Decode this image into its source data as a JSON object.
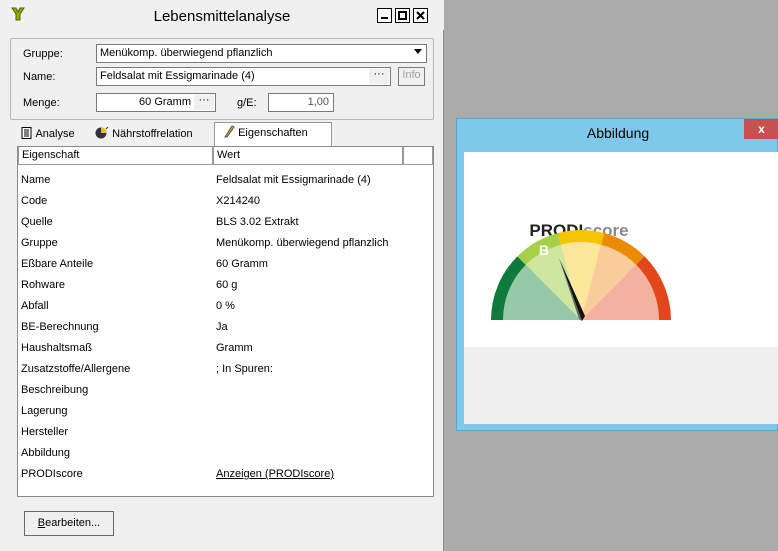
{
  "window": {
    "title": "Lebensmittelanalyse"
  },
  "fields": {
    "gruppe_label": "Gruppe:",
    "gruppe_value": "Menükomp. überwiegend pflanzlich",
    "name_label": "Name:",
    "name_value": "Feldsalat mit Essigmarinade (4)",
    "name_btn": "···",
    "info_btn": "Info",
    "menge_label": "Menge:",
    "menge_value": "60 Gramm",
    "menge_btn": "···",
    "ge_label": "g/E:",
    "ge_value": "1,00"
  },
  "tabs": [
    {
      "label": "Analyse"
    },
    {
      "label": "Nährstoffrelation"
    },
    {
      "label": "Eigenschaften"
    }
  ],
  "table": {
    "headers": [
      "Eigenschaft",
      "Wert"
    ],
    "rows": [
      {
        "key": "Name",
        "value": "Feldsalat mit Essigmarinade (4)"
      },
      {
        "key": "Code",
        "value": "X214240"
      },
      {
        "key": "Quelle",
        "value": "BLS 3.02 Extrakt"
      },
      {
        "key": "Gruppe",
        "value": "Menükomp. überwiegend pflanzlich"
      },
      {
        "key": "Eßbare Anteile",
        "value": "60 Gramm"
      },
      {
        "key": "Rohware",
        "value": "60 g"
      },
      {
        "key": "Abfall",
        "value": "0 %"
      },
      {
        "key": "BE-Berechnung",
        "value": "Ja"
      },
      {
        "key": "Haushaltsmaß",
        "value": "Gramm"
      },
      {
        "key": "Zusatzstoffe/Allergene",
        "value": "; In Spuren:"
      },
      {
        "key": "Beschreibung",
        "value": ""
      },
      {
        "key": "Lagerung",
        "value": ""
      },
      {
        "key": "Hersteller",
        "value": ""
      },
      {
        "key": "Abbildung",
        "value": ""
      },
      {
        "key": "PRODIscore",
        "value": "Anzeigen (PRODIscore)"
      }
    ]
  },
  "edit_button": "Bearbeiten...",
  "side_window": {
    "title": "Abbildung",
    "close": "x",
    "logo_bold": "PRODI",
    "logo_light": "score",
    "score_letter": "B"
  },
  "colors": {
    "accent_titlebar": "#7ec8e9",
    "close_red": "#c75050"
  }
}
